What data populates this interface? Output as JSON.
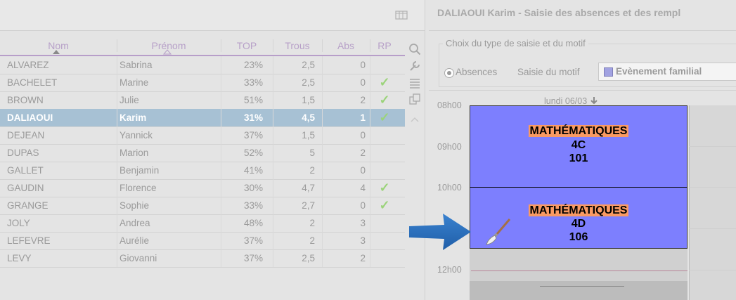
{
  "left_panel": {
    "columns": [
      "Nom",
      "Prénom",
      "TOP",
      "Trous",
      "Abs",
      "RP"
    ],
    "rows": [
      {
        "nom": "ALVAREZ",
        "prenom": "Sabrina",
        "top": "23%",
        "trous": "2,5",
        "abs": "0",
        "rp": ""
      },
      {
        "nom": "BACHELET",
        "prenom": "Marine",
        "top": "33%",
        "trous": "2,5",
        "abs": "0",
        "rp": "✓"
      },
      {
        "nom": "BROWN",
        "prenom": "Julie",
        "top": "51%",
        "trous": "1,5",
        "abs": "2",
        "rp": "✓"
      },
      {
        "nom": "DALIAOUI",
        "prenom": "Karim",
        "top": "31%",
        "trous": "4,5",
        "abs": "1",
        "rp": "✓"
      },
      {
        "nom": "DEJEAN",
        "prenom": "Yannick",
        "top": "37%",
        "trous": "1,5",
        "abs": "0",
        "rp": ""
      },
      {
        "nom": "DUPAS",
        "prenom": "Marion",
        "top": "52%",
        "trous": "5",
        "abs": "2",
        "rp": ""
      },
      {
        "nom": "GALLET",
        "prenom": "Benjamin",
        "top": "41%",
        "trous": "2",
        "abs": "0",
        "rp": ""
      },
      {
        "nom": "GAUDIN",
        "prenom": "Florence",
        "top": "30%",
        "trous": "4,7",
        "abs": "4",
        "rp": "✓"
      },
      {
        "nom": "GRANGE",
        "prenom": "Sophie",
        "top": "33%",
        "trous": "2,7",
        "abs": "0",
        "rp": "✓"
      },
      {
        "nom": "JOLY",
        "prenom": "Andrea",
        "top": "48%",
        "trous": "2",
        "abs": "3",
        "rp": ""
      },
      {
        "nom": "LEFEVRE",
        "prenom": "Aurélie",
        "top": "37%",
        "trous": "2",
        "abs": "3",
        "rp": ""
      },
      {
        "nom": "LEVY",
        "prenom": "Giovanni",
        "top": "37%",
        "trous": "2,5",
        "abs": "2",
        "rp": ""
      }
    ],
    "selected_row": "DALIAOUI"
  },
  "right_panel": {
    "title": "DALIAOUI Karim - Saisie des absences et des rempl",
    "group_legend": "Choix du type de saisie et du motif",
    "radio_label": "Absences",
    "motif_label": "Saisie du motif",
    "motif_value": "Evènement familial",
    "day_label": "lundi 06/03",
    "hours": [
      "08h00",
      "09h00",
      "10h00",
      "12h00"
    ],
    "courses": [
      {
        "subject": "MATHÉMATIQUES",
        "class": "4C",
        "room": "101"
      },
      {
        "subject": "MATHÉMATIQUES",
        "class": "4D",
        "room": "106"
      }
    ]
  },
  "colors": {
    "course_bg": "#7d7ffe",
    "subject_bg": "#f99a63",
    "selected_row_bg": "#a7c1d4",
    "check_green": "#9bd37a",
    "arrow_blue": "#2e6db5"
  }
}
